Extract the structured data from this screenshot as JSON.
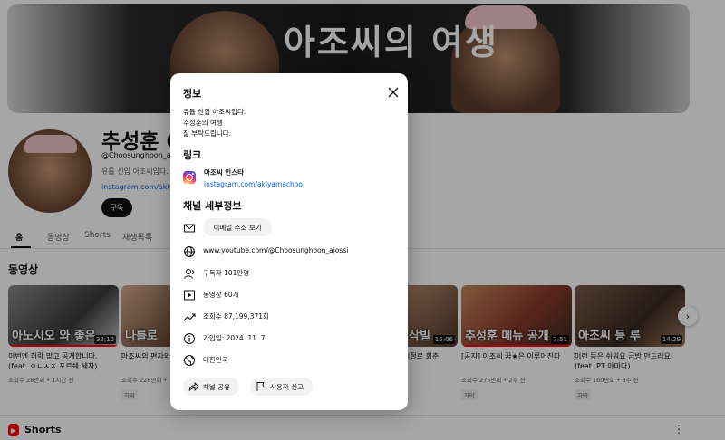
{
  "banner": {
    "title": "아조씨의 여생"
  },
  "channel": {
    "name": "추성훈 C",
    "handle": "@Choosunghoon_ajo",
    "description": "유튭 신입 아조씨입다.",
    "link": "instagram.com/akiya",
    "subscribe_label": "구독"
  },
  "tabs": [
    {
      "label": "홈",
      "active": true
    },
    {
      "label": "동영상",
      "active": false
    },
    {
      "label": "Shorts",
      "active": false
    },
    {
      "label": "재생목록",
      "active": false
    }
  ],
  "videos_section": {
    "title": "동영상"
  },
  "videos": [
    {
      "thumb_caption": "아노시오 와 좋은",
      "duration": "32:10",
      "title": "이번엔 허락 맡고 공개합니다. (feat. ㅇㄴㅅㅊ 포르쉐 세차)",
      "meta": "조회수 28만회 • 1시간 전",
      "tag": ""
    },
    {
      "thumb_caption": "나를로",
      "duration": "",
      "title": "아조씨의 편자와 (100% 아조씨 실",
      "meta": "조회수 228만회 •",
      "tag": "자막"
    },
    {
      "thumb_caption": "삭빌",
      "duration": "15:06",
      "title": "시절로 회춘",
      "meta": "",
      "tag": ""
    },
    {
      "thumb_caption": "추성훈 메뉴 공개",
      "duration": "7:51",
      "title": "[공지] 아조씨 꿈★은 이루어진다",
      "meta": "조회수 275만회 • 2주 전",
      "tag": "자막"
    },
    {
      "thumb_caption": "아조씨 등 루",
      "duration": "14:29",
      "title": "이런 등은 쉬워요 금방 만드러요 (feat. PT 아마다)",
      "meta": "조회수 160만회 • 3주 전",
      "tag": "자막"
    }
  ],
  "shorts_section": {
    "title": "Shorts"
  },
  "modal": {
    "about_heading": "정보",
    "description": "유튭 신입 아조씨입다.\n추성훈의 여생\n잘 부탁드립니다.",
    "links_heading": "링크",
    "link_name": "아조씨 인스타",
    "link_url": "instagram.com/akiyamachoo",
    "details_heading": "채널 세부정보",
    "email_button": "이메일 주소 보기",
    "url": "www.youtube.com/@Choosunghoon_ajossi",
    "subscribers": "구독자 101만명",
    "videos": "동영상 60개",
    "views": "조회수 87,199,371회",
    "joined": "가입일: 2024. 11. 7.",
    "country": "대한민국",
    "share_button": "채널 공유",
    "report_button": "사용자 신고"
  },
  "colors": {
    "link": "#065fd4",
    "accent_red": "#ff0000"
  },
  "icons": [
    "close-icon",
    "instagram-icon",
    "mail-icon",
    "globe-icon",
    "person-icon",
    "video-icon",
    "trending-icon",
    "info-icon",
    "location-icon",
    "share-icon",
    "flag-icon",
    "chevron-right-icon",
    "shorts-icon"
  ]
}
